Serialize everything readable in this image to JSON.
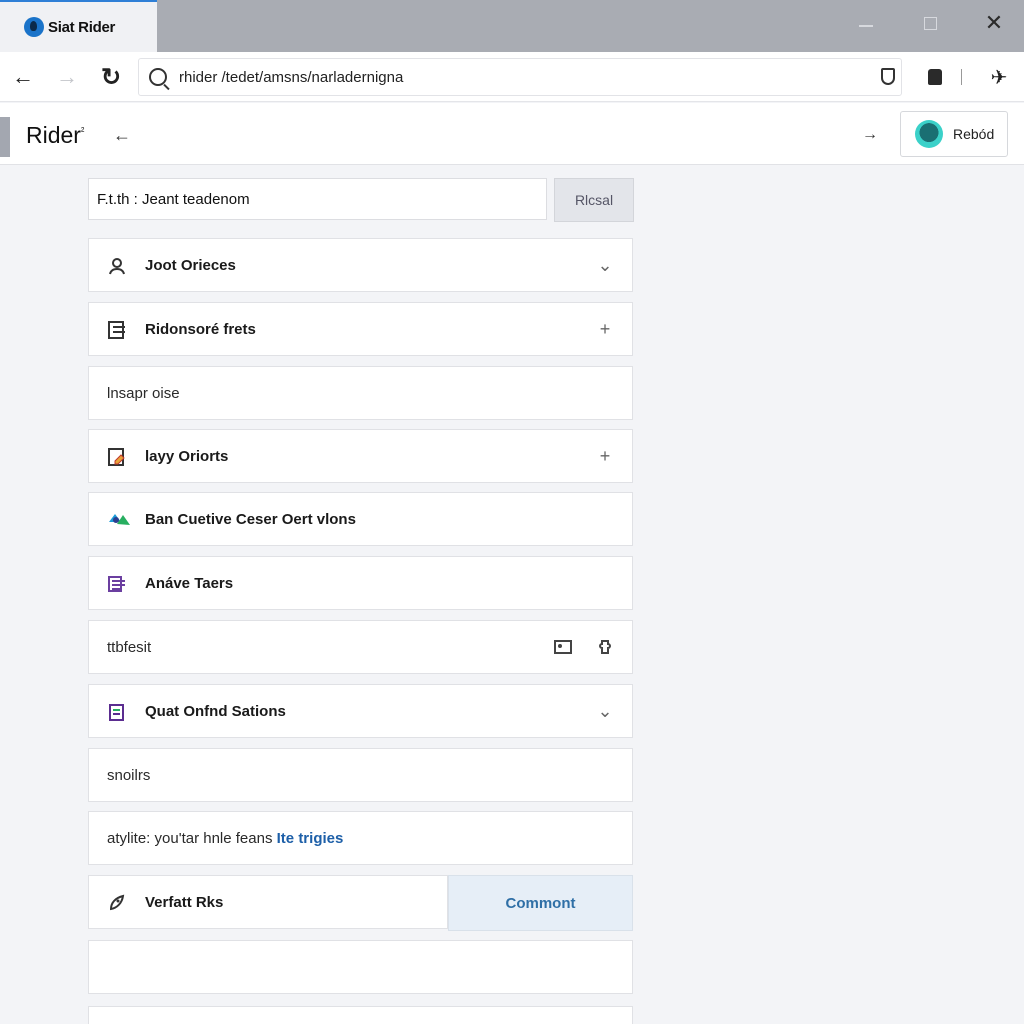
{
  "browser": {
    "tab_title": "Siat Rider",
    "url": "rhider /tedet/amsns/narladernigna",
    "window_controls": {
      "minimize": "—",
      "maximize": "",
      "close": "✕"
    }
  },
  "app": {
    "title": "Rider",
    "title_sup": "²",
    "profile_label": "Rebód"
  },
  "search": {
    "value": "F.t.th : Jeant teadenom",
    "button_label": "Rlcsal"
  },
  "rows": [
    {
      "label": "Joot Orieces",
      "icon": "user-icon",
      "trailing": "chevron-down"
    },
    {
      "label": "Ridonsoré frets",
      "icon": "layout-icon",
      "trailing": "plus"
    },
    {
      "label": "lnsapr oise",
      "icon": "",
      "trailing": ""
    },
    {
      "label": "layy Oriorts",
      "icon": "edit-doc-icon",
      "trailing": "plus"
    },
    {
      "label": "Ban Cuetive Ceser Oert vlons",
      "icon": "colorful-tag-icon",
      "trailing": ""
    },
    {
      "label": "Anáve Taers",
      "icon": "list-icon",
      "trailing": ""
    },
    {
      "label": "ttbfesit",
      "icon": "",
      "trailing": "puzzle-and-image"
    },
    {
      "label": "Quat Onfnd Sations",
      "icon": "calendar-icon",
      "trailing": "chevron-down"
    },
    {
      "label": "snoilrs",
      "icon": "",
      "trailing": ""
    },
    {
      "label": "atylite: you'tar hnle feans",
      "link": "Ite trigies",
      "icon": "",
      "trailing": ""
    },
    {
      "label": "Verfatt Rks",
      "icon": "rocket-icon",
      "trailing": ""
    }
  ],
  "comment_button": "Commont",
  "colors": {
    "accent_blue": "#2f7fd6",
    "link_blue": "#1d5fa8",
    "comment_bg": "#e6eef7"
  }
}
